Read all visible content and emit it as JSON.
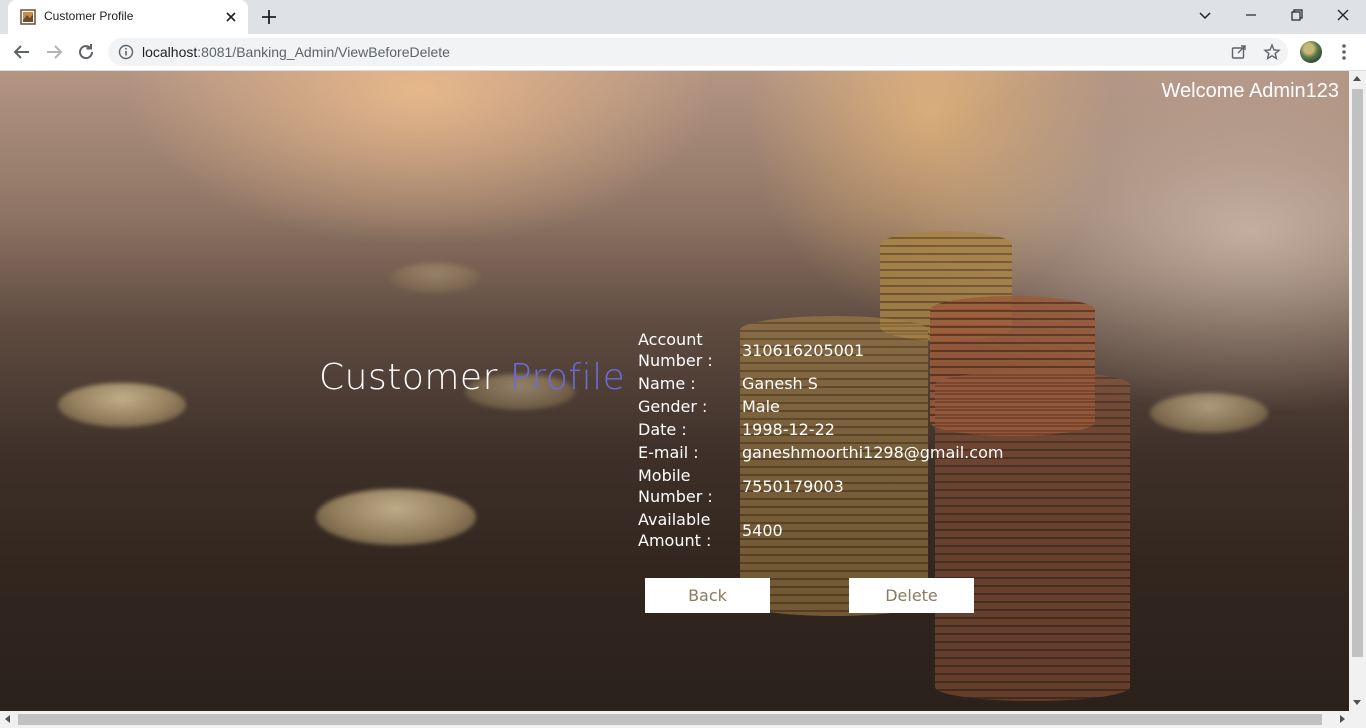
{
  "browser": {
    "tab_title": "Customer Profile",
    "url_host": "localhost",
    "url_rest": ":8081/Banking_Admin/ViewBeforeDelete"
  },
  "page": {
    "welcome": "Welcome Admin123",
    "heading_main": "Customer ",
    "heading_accent": "Profile",
    "accent_color": "#6b6bd9",
    "fields": [
      {
        "label": "Account Number :",
        "value": "310616205001"
      },
      {
        "label": "Name :",
        "value": "Ganesh S"
      },
      {
        "label": "Gender :",
        "value": "Male"
      },
      {
        "label": "Date :",
        "value": "1998-12-22"
      },
      {
        "label": "E-mail :",
        "value": "ganeshmoorthi1298@gmail.com"
      },
      {
        "label": "Mobile Number :",
        "value": "7550179003"
      },
      {
        "label": "Available Amount :",
        "value": "5400"
      }
    ],
    "back_label": "Back",
    "delete_label": "Delete"
  }
}
